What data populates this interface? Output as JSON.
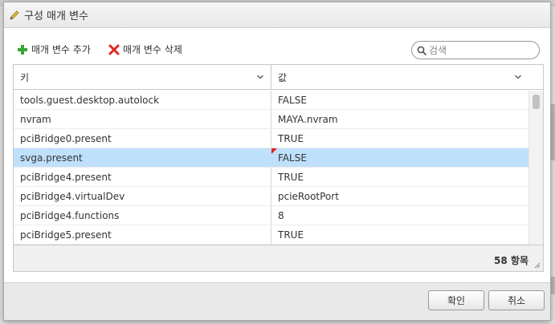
{
  "dialog": {
    "title": "구성 매개 변수"
  },
  "toolbar": {
    "add_label": "매개 변수 추가",
    "delete_label": "매개 변수 삭제",
    "search_placeholder": "검색"
  },
  "grid": {
    "columns": [
      {
        "label": "키"
      },
      {
        "label": "값"
      }
    ],
    "rows": [
      {
        "key": "tools.guest.desktop.autolock",
        "value": "FALSE"
      },
      {
        "key": "nvram",
        "value": "MAYA.nvram"
      },
      {
        "key": "pciBridge0.present",
        "value": "TRUE"
      },
      {
        "key": "svga.present",
        "value": "FALSE",
        "selected": true
      },
      {
        "key": "pciBridge4.present",
        "value": "TRUE"
      },
      {
        "key": "pciBridge4.virtualDev",
        "value": "pcieRootPort"
      },
      {
        "key": "pciBridge4.functions",
        "value": "8"
      },
      {
        "key": "pciBridge5.present",
        "value": "TRUE"
      }
    ],
    "item_count": "58 항목"
  },
  "footer": {
    "ok_label": "확인",
    "cancel_label": "취소"
  },
  "colors": {
    "selected_row": "#bfe0fb",
    "add_icon": "#3aa536",
    "delete_icon": "#e0281e"
  },
  "icons": {
    "title": "pencil-icon",
    "add": "plus-icon",
    "delete": "x-icon",
    "search": "search-icon",
    "sort": "chevron-down-icon"
  }
}
